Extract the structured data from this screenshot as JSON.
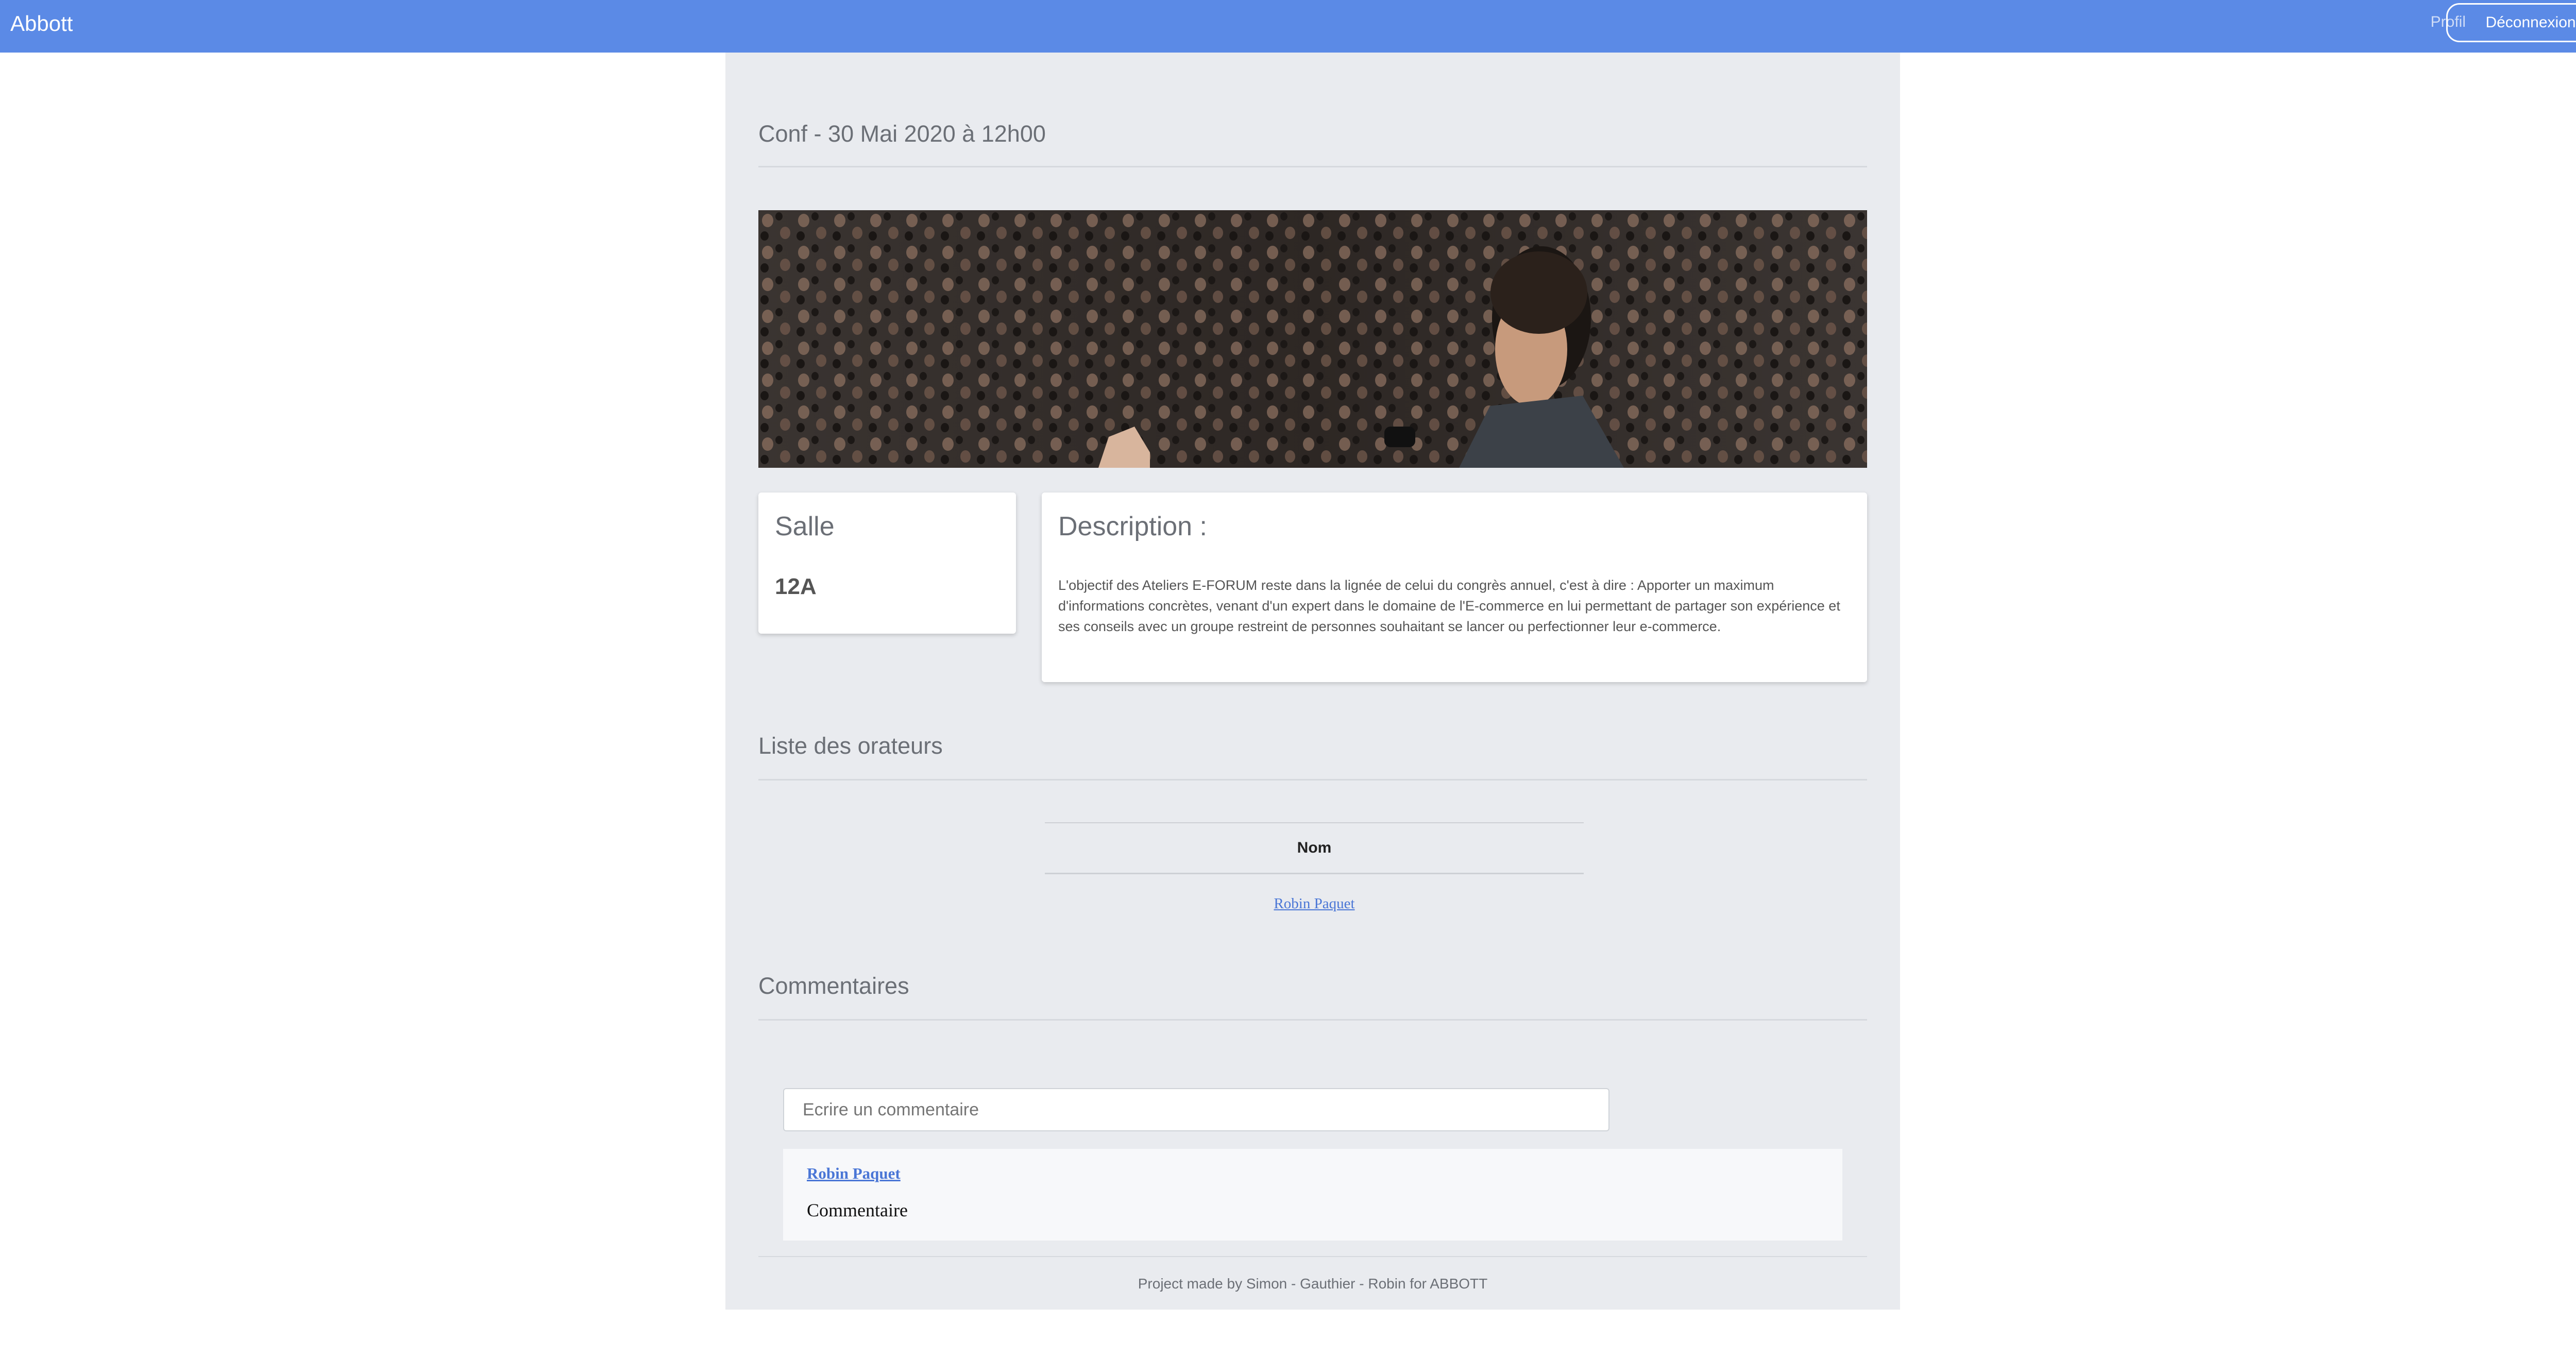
{
  "navbar": {
    "brand": "Abbott",
    "profile_label": "Profil",
    "logout_label": "Déconnexion"
  },
  "event": {
    "title": "Conf - 30 Mai 2020 à 12h00"
  },
  "room_card": {
    "title": "Salle",
    "value": "12A"
  },
  "description_card": {
    "title": "Description :",
    "text": "L'objectif des Ateliers E-FORUM reste dans la lignée de celui du congrès annuel, c'est à dire : Apporter un maximum d'informations concrètes, venant d'un expert dans le domaine de l'E-commerce en lui permettant de partager son expérience et ses conseils avec un groupe restreint de personnes souhaitant se lancer ou perfectionner leur e-commerce."
  },
  "speakers": {
    "title": "Liste des orateurs",
    "column_header": "Nom",
    "rows": [
      {
        "name": "Robin Paquet"
      }
    ]
  },
  "comments": {
    "title": "Commentaires",
    "input_placeholder": "Ecrire un commentaire",
    "items": [
      {
        "author": "Robin Paquet",
        "text": "Commentaire"
      }
    ]
  },
  "footer": {
    "text": "Project made by Simon - Gauthier - Robin for ABBOTT"
  },
  "colors": {
    "navbar": "#5b8ae6",
    "main_background": "#e9ebef",
    "link": "#4a76d6"
  }
}
